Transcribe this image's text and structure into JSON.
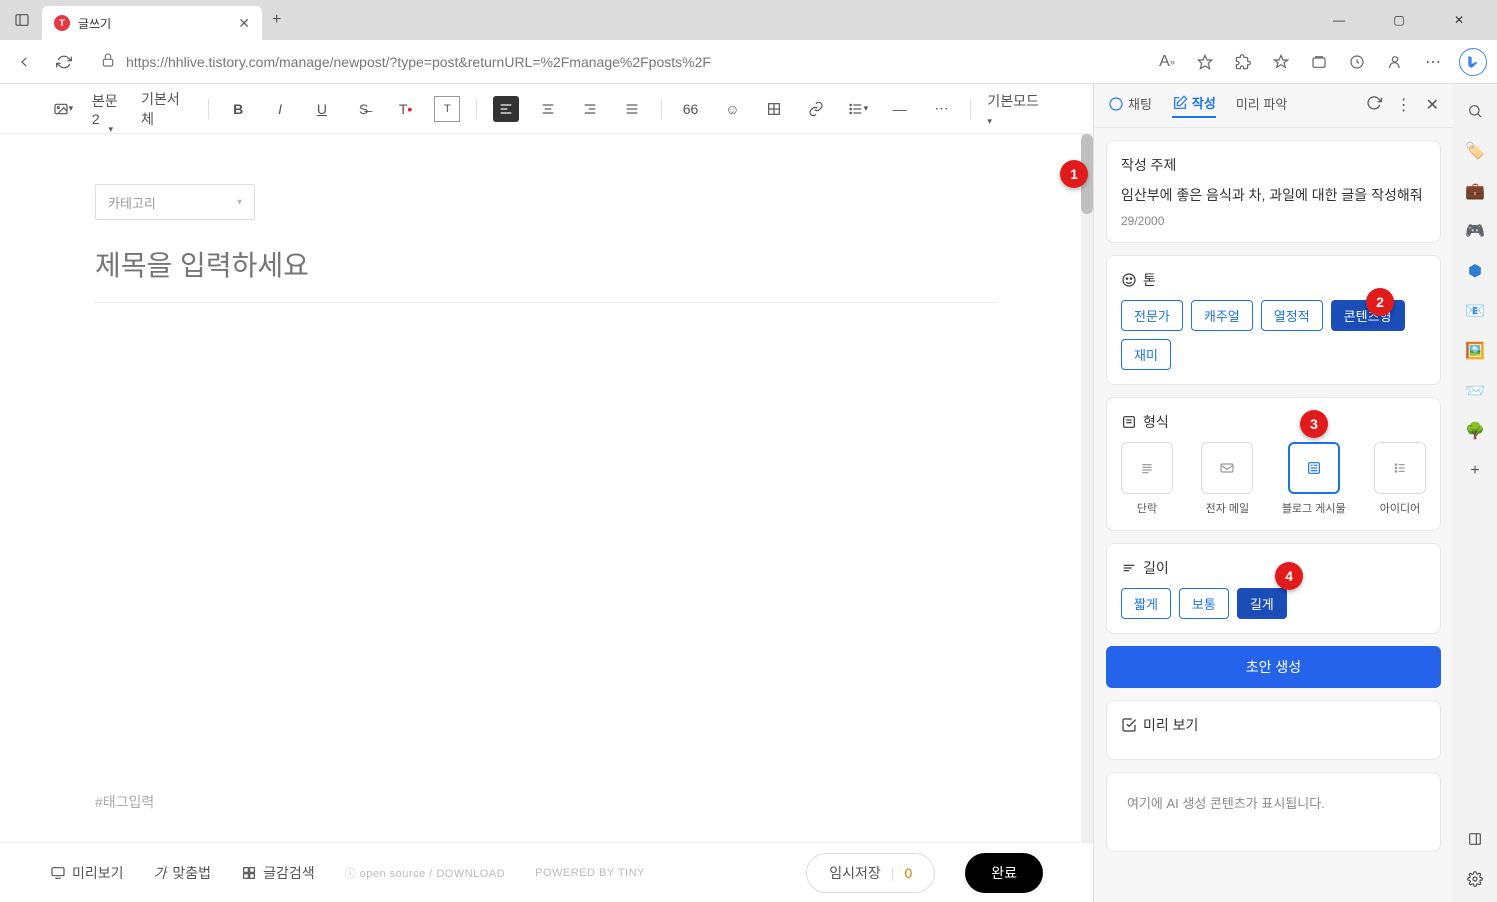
{
  "tab": {
    "title": "글쓰기",
    "favicon": "T"
  },
  "url": "https://hhlive.tistory.com/manage/newpost/?type=post&returnURL=%2Fmanage%2Fposts%2F",
  "toolbar": {
    "text_style1": "본문2",
    "text_style2": "기본서체",
    "mode": "기본모드"
  },
  "editor": {
    "category_placeholder": "카테고리",
    "title_placeholder": "제목을 입력하세요",
    "tag_placeholder": "#태그입력"
  },
  "bottombar": {
    "preview": "미리보기",
    "spell": "맞춤법",
    "sense": "글감검색",
    "opensource": "open source / DOWNLOAD",
    "powered": "POWERED BY TINY",
    "tempsave": "임시저장",
    "tempcount": "0",
    "done": "완료"
  },
  "ai": {
    "tabs": {
      "chat": "채팅",
      "write": "작성",
      "insight": "미리 파악"
    },
    "topic_label": "작성 주제",
    "topic_text": "임산부에 좋은 음식과 차, 과일에 대한 글을 작성해줘",
    "charcount": "29/2000",
    "tone_label": "톤",
    "tones": {
      "pro": "전문가",
      "casual": "캐주얼",
      "passion": "열정적",
      "content": "콘텐츠형",
      "fun": "재미"
    },
    "format_label": "형식",
    "formats": {
      "para": "단락",
      "email": "전자 메일",
      "blog": "블로그 게시물",
      "idea": "아이디어"
    },
    "length_label": "길이",
    "lengths": {
      "short": "짧게",
      "medium": "보통",
      "long": "길게"
    },
    "generate": "초안 생성",
    "preview_label": "미리 보기",
    "preview_placeholder": "여기에 AI 생성 콘텐츠가 표시됩니다."
  },
  "badges": {
    "b1": "1",
    "b2": "2",
    "b3": "3",
    "b4": "4"
  }
}
